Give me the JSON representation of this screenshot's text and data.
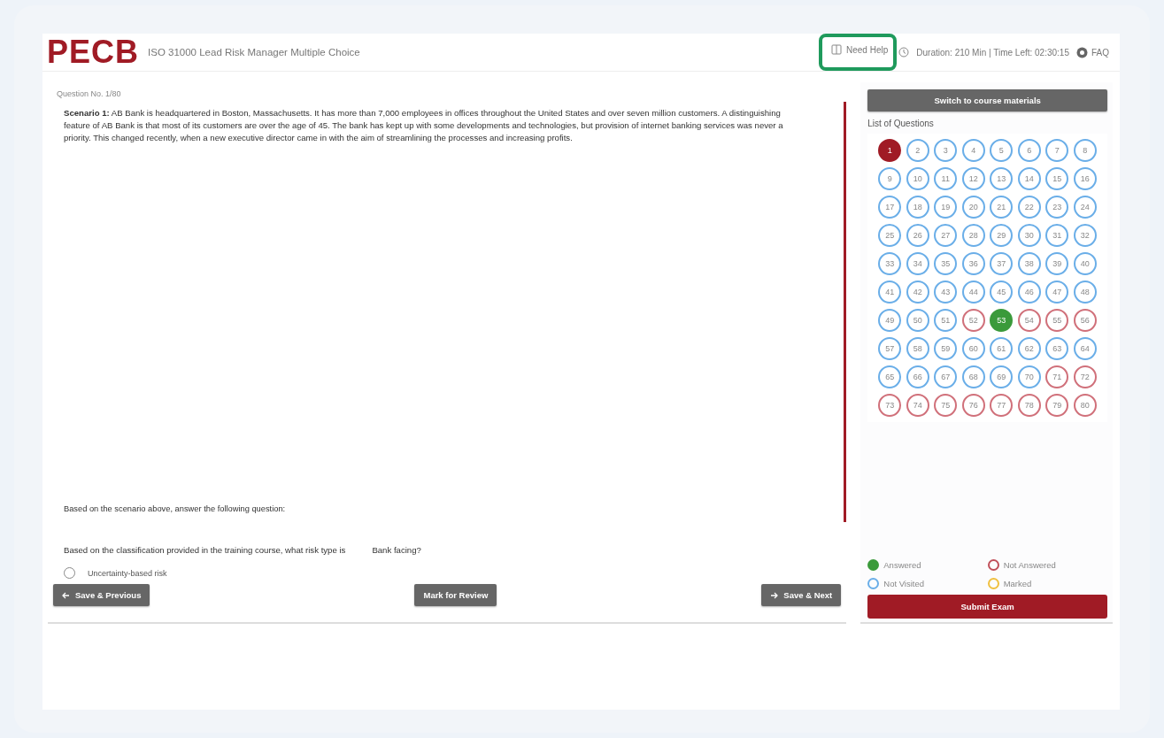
{
  "header": {
    "logo": "PECB",
    "exam_title": "ISO 31000 Lead Risk Manager Multiple Choice",
    "help": {
      "label": "Need Help",
      "highlighted": true
    },
    "timer": "Duration: 210 Min | Time Left: 02:30:15",
    "faq": "FAQ"
  },
  "question": {
    "number": "Question No. 1/80",
    "scenario": "**Scenario 1:** AB Bank is headquartered in Boston, Massachusetts. It has more than 7,000 employees in offices throughout the United States and over seven million customers. A distinguishing feature of AB Bank is that most of its customers are over the age of 45. The bank has kept up with some developments and technologies, but provision of internet banking services was never a priority. This changed recently, when a new executive director came in with the aim of streamlining the processes and increasing profits.",
    "instruction": "Based on the scenario above, answer the following question:",
    "prompt_start": "Based on the classification provided in the training course, what risk type is",
    "prompt_end": "Bank facing?",
    "options": [
      {
        "label": "Uncertainty-based risk",
        "selected": false
      }
    ]
  },
  "buttons": {
    "previous": "Save & Previous",
    "review": "Mark for Review",
    "next": "Save & Next"
  },
  "sidebar": {
    "switch_button": "Switch to course materials",
    "list_title": "List of Questions",
    "questions": [
      {
        "label": "1",
        "kind": "current"
      },
      {
        "label": "2",
        "kind": "not_visited"
      },
      {
        "label": "3",
        "kind": "not_visited"
      },
      {
        "label": "4",
        "kind": "not_visited"
      },
      {
        "label": "5",
        "kind": "not_visited"
      },
      {
        "label": "6",
        "kind": "not_visited"
      },
      {
        "label": "7",
        "kind": "not_visited"
      },
      {
        "label": "8",
        "kind": "not_visited"
      },
      {
        "label": "9",
        "kind": "not_visited"
      },
      {
        "label": "10",
        "kind": "not_visited"
      },
      {
        "label": "11",
        "kind": "not_visited"
      },
      {
        "label": "12",
        "kind": "not_visited"
      },
      {
        "label": "13",
        "kind": "not_visited"
      },
      {
        "label": "14",
        "kind": "not_visited"
      },
      {
        "label": "15",
        "kind": "not_visited"
      },
      {
        "label": "16",
        "kind": "not_visited"
      },
      {
        "label": "17",
        "kind": "not_visited"
      },
      {
        "label": "18",
        "kind": "not_visited"
      },
      {
        "label": "19",
        "kind": "not_visited"
      },
      {
        "label": "20",
        "kind": "not_visited"
      },
      {
        "label": "21",
        "kind": "not_visited"
      },
      {
        "label": "22",
        "kind": "not_visited"
      },
      {
        "label": "23",
        "kind": "not_visited"
      },
      {
        "label": "24",
        "kind": "not_visited"
      },
      {
        "label": "25",
        "kind": "not_visited"
      },
      {
        "label": "26",
        "kind": "not_visited"
      },
      {
        "label": "27",
        "kind": "not_visited"
      },
      {
        "label": "28",
        "kind": "not_visited"
      },
      {
        "label": "29",
        "kind": "not_visited"
      },
      {
        "label": "30",
        "kind": "not_visited"
      },
      {
        "label": "31",
        "kind": "not_visited"
      },
      {
        "label": "32",
        "kind": "not_visited"
      },
      {
        "label": "33",
        "kind": "not_visited"
      },
      {
        "label": "34",
        "kind": "not_visited"
      },
      {
        "label": "35",
        "kind": "not_visited"
      },
      {
        "label": "36",
        "kind": "not_visited"
      },
      {
        "label": "37",
        "kind": "not_visited"
      },
      {
        "label": "38",
        "kind": "not_visited"
      },
      {
        "label": "39",
        "kind": "not_visited"
      },
      {
        "label": "40",
        "kind": "not_visited"
      },
      {
        "label": "41",
        "kind": "not_visited"
      },
      {
        "label": "42",
        "kind": "not_visited"
      },
      {
        "label": "43",
        "kind": "not_visited"
      },
      {
        "label": "44",
        "kind": "not_visited"
      },
      {
        "label": "45",
        "kind": "not_visited"
      },
      {
        "label": "46",
        "kind": "not_visited"
      },
      {
        "label": "47",
        "kind": "not_visited"
      },
      {
        "label": "48",
        "kind": "not_visited"
      },
      {
        "label": "49",
        "kind": "not_visited"
      },
      {
        "label": "50",
        "kind": "not_visited"
      },
      {
        "label": "51",
        "kind": "not_visited"
      },
      {
        "label": "52",
        "kind": "not_answered"
      },
      {
        "label": "53",
        "kind": "answered"
      },
      {
        "label": "54",
        "kind": "not_answered"
      },
      {
        "label": "55",
        "kind": "not_answered"
      },
      {
        "label": "56",
        "kind": "not_answered"
      },
      {
        "label": "57",
        "kind": "not_visited"
      },
      {
        "label": "58",
        "kind": "not_visited"
      },
      {
        "label": "59",
        "kind": "not_visited"
      },
      {
        "label": "60",
        "kind": "not_visited"
      },
      {
        "label": "61",
        "kind": "not_visited"
      },
      {
        "label": "62",
        "kind": "not_visited"
      },
      {
        "label": "63",
        "kind": "not_visited"
      },
      {
        "label": "64",
        "kind": "not_visited"
      },
      {
        "label": "65",
        "kind": "not_visited"
      },
      {
        "label": "66",
        "kind": "not_visited"
      },
      {
        "label": "67",
        "kind": "not_visited"
      },
      {
        "label": "68",
        "kind": "not_visited"
      },
      {
        "label": "69",
        "kind": "not_visited"
      },
      {
        "label": "70",
        "kind": "not_visited"
      },
      {
        "label": "71",
        "kind": "not_answered"
      },
      {
        "label": "72",
        "kind": "not_answered"
      },
      {
        "label": "73",
        "kind": "not_answered"
      },
      {
        "label": "74",
        "kind": "not_answered"
      },
      {
        "label": "75",
        "kind": "not_answered"
      },
      {
        "label": "76",
        "kind": "not_answered"
      },
      {
        "label": "77",
        "kind": "not_answered"
      },
      {
        "label": "78",
        "kind": "not_answered"
      },
      {
        "label": "79",
        "kind": "not_answered"
      },
      {
        "label": "80",
        "kind": "not_answered"
      }
    ],
    "legend": [
      {
        "label": "Answered",
        "kind": "answered"
      },
      {
        "label": "Not Answered",
        "kind": "not_answered"
      },
      {
        "label": "Not Visited",
        "kind": "not_visited"
      },
      {
        "label": "Marked",
        "kind": "marked"
      }
    ],
    "submit": "Submit Exam"
  }
}
